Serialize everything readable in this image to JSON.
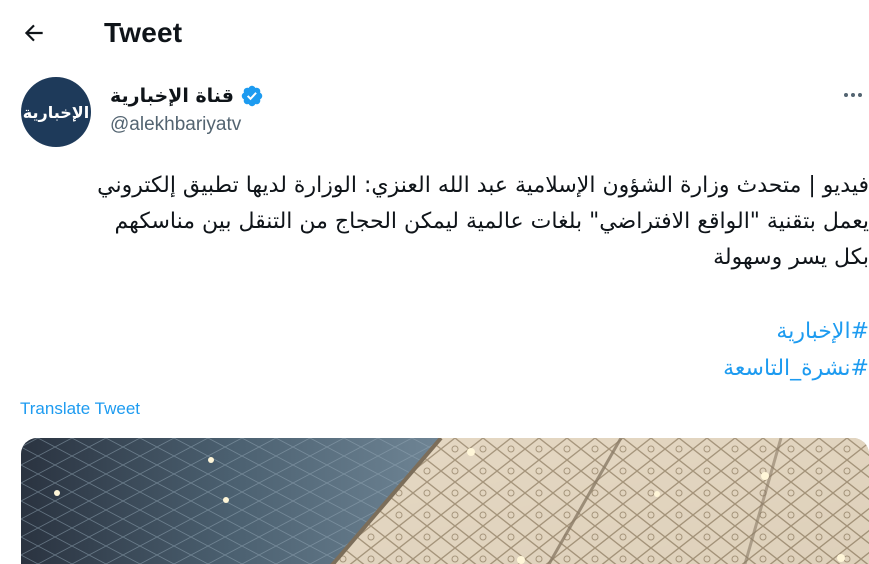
{
  "header": {
    "title": "Tweet"
  },
  "author": {
    "name": "قناة الإخبارية",
    "handle": "@alekhbariyatv",
    "avatar_text": "الإخبارية",
    "verified": true
  },
  "tweet": {
    "lines": [
      "فيديو | متحدث وزارة الشؤون الإسلامية عبد الله العنزي: الوزارة لديها تطبيق إلكتروني",
      "يعمل بتقنية \"الواقع الافتراضي\" بلغات عالمية ليمكن الحجاج من التنقل بين مناسكهم",
      "بكل يسر وسهولة"
    ],
    "hashtags": [
      "#الإخبارية",
      "#نشرة_التاسعة"
    ],
    "translate_label": "Translate Tweet"
  },
  "colors": {
    "link": "#1d9bf0",
    "secondary_text": "#536471",
    "primary_text": "#0f1419",
    "verified_badge": "#1d9bf0"
  },
  "icons": {
    "back": "arrow-left-icon",
    "more": "more-horizontal-icon",
    "verified": "verified-badge-icon"
  }
}
